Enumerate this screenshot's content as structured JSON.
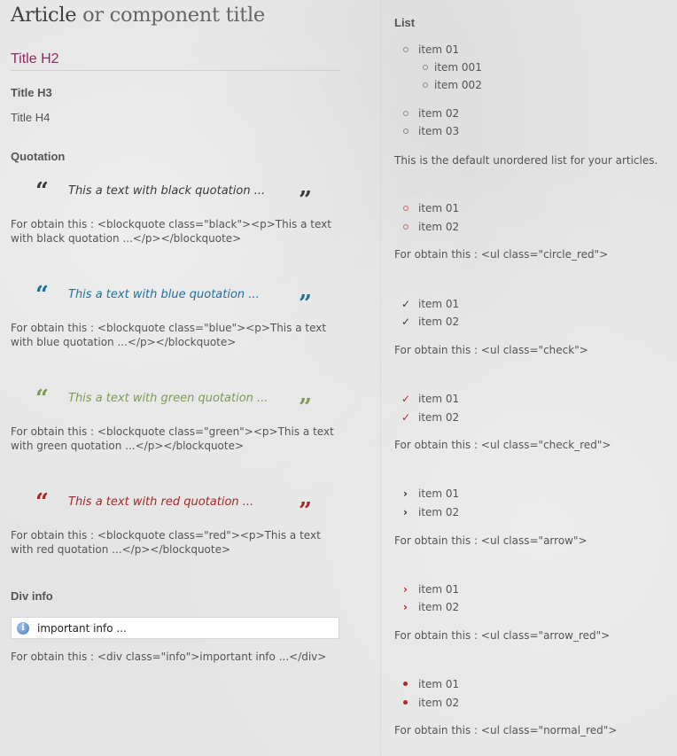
{
  "left": {
    "title_first": "Article",
    "title_rest": " or component title",
    "h2": "Title H2",
    "h3": "Title H3",
    "h4": "Title H4",
    "quotation_label": "Quotation",
    "quotes": [
      {
        "variant": "black",
        "color": "#3a3a3a",
        "text": "This a text with black quotation ...",
        "code_line1": "For obtain this : <blockquote class=\"black\"><p>This a text",
        "code_line2": "with black quotation ...</p></blockquote>"
      },
      {
        "variant": "blue",
        "color": "#1f6f9e",
        "text": "This a text with blue quotation ...",
        "code_line1": "For obtain this : <blockquote class=\"blue\"><p>This a text",
        "code_line2": "with blue quotation ...</p></blockquote>"
      },
      {
        "variant": "green",
        "color": "#7f9a52",
        "text": "This a text with green quotation ...",
        "code_line1": "For obtain this : <blockquote class=\"green\"><p>This a text",
        "code_line2": "with green quotation ...</p></blockquote>"
      },
      {
        "variant": "red",
        "color": "#a52828",
        "text": "This a text with red quotation ...",
        "code_line1": "For obtain this : <blockquote class=\"red\"><p>This a text",
        "code_line2": "with red quotation ...</p></blockquote>"
      }
    ],
    "div_info_label": "Div info",
    "info_icon": "info-icon",
    "info_text": "important info ...",
    "info_code": "For obtain this : <div class=\"info\">important info ...</div>"
  },
  "right": {
    "list_title": "List",
    "default_list": {
      "items": [
        "item 01",
        "item 001",
        "item 002",
        "item 02",
        "item 03"
      ],
      "note": "This is the default unordered list for your articles."
    },
    "circle_red": {
      "items": [
        "item 01",
        "item 02"
      ],
      "note": "For obtain this : <ul class=\"circle_red\">"
    },
    "check": {
      "items": [
        "item 01",
        "item 02"
      ],
      "note": "For obtain this : <ul class=\"check\">"
    },
    "check_red": {
      "items": [
        "item 01",
        "item 02"
      ],
      "note": "For obtain this : <ul class=\"check_red\">"
    },
    "arrow": {
      "items": [
        "item 01",
        "item 02"
      ],
      "note": "For obtain this : <ul class=\"arrow\">"
    },
    "arrow_red": {
      "items": [
        "item 01",
        "item 02"
      ],
      "note": "For obtain this : <ul class=\"arrow_red\">"
    },
    "normal_red": {
      "items": [
        "item 01",
        "item 02"
      ],
      "note": "For obtain this : <ul class=\"normal_red\">"
    }
  }
}
